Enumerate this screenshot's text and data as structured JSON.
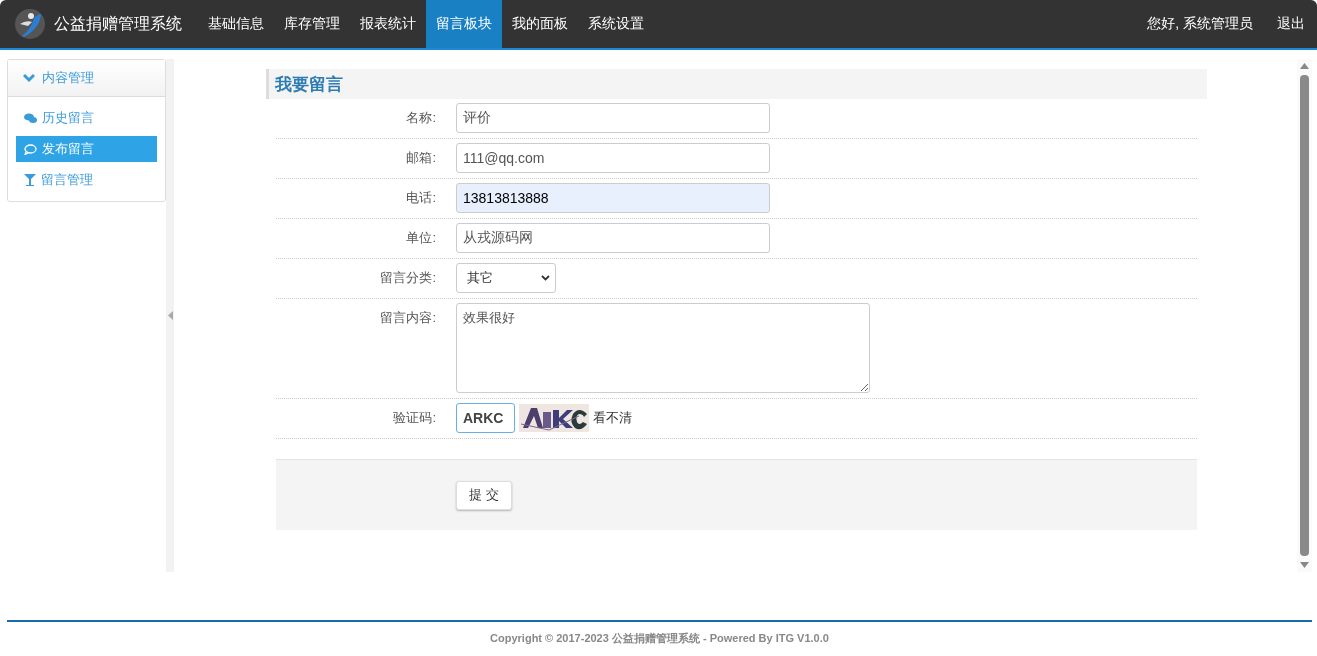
{
  "app": {
    "title": "公益捐赠管理系统"
  },
  "nav": [
    {
      "label": "基础信息",
      "selected": false
    },
    {
      "label": "库存管理",
      "selected": false
    },
    {
      "label": "报表统计",
      "selected": false
    },
    {
      "label": "留言板块",
      "selected": true
    },
    {
      "label": "我的面板",
      "selected": false
    },
    {
      "label": "系统设置",
      "selected": false
    }
  ],
  "user": {
    "greeting": "您好, 系统管理员",
    "logout": "退出"
  },
  "sidebar": {
    "group": {
      "label": "内容管理",
      "expanded": true
    },
    "items": [
      {
        "label": "历史留言",
        "selected": false
      },
      {
        "label": "发布留言",
        "selected": true
      },
      {
        "label": "留言管理",
        "selected": false
      }
    ]
  },
  "form": {
    "title": "我要留言",
    "fields": [
      {
        "kind": "text",
        "label": "名称:",
        "value": "评价",
        "autofilled": false
      },
      {
        "kind": "text",
        "label": "邮箱:",
        "value": "111@qq.com",
        "autofilled": false
      },
      {
        "kind": "text",
        "label": "电话:",
        "value": "13813813888",
        "autofilled": true
      },
      {
        "kind": "text",
        "label": "单位:",
        "value": "从戎源码网",
        "autofilled": false
      },
      {
        "kind": "select",
        "label": "留言分类:",
        "value": "其它"
      },
      {
        "kind": "textarea",
        "label": "留言内容:",
        "value": "效果很好"
      },
      {
        "kind": "captcha",
        "label": "验证码:",
        "value": "ARKC",
        "focused": true,
        "refresh": "看不清"
      }
    ],
    "submit": "提 交"
  },
  "footer": "Copyright © 2017-2023 公益捐赠管理系统 - Powered By ITG V1.0.0"
}
